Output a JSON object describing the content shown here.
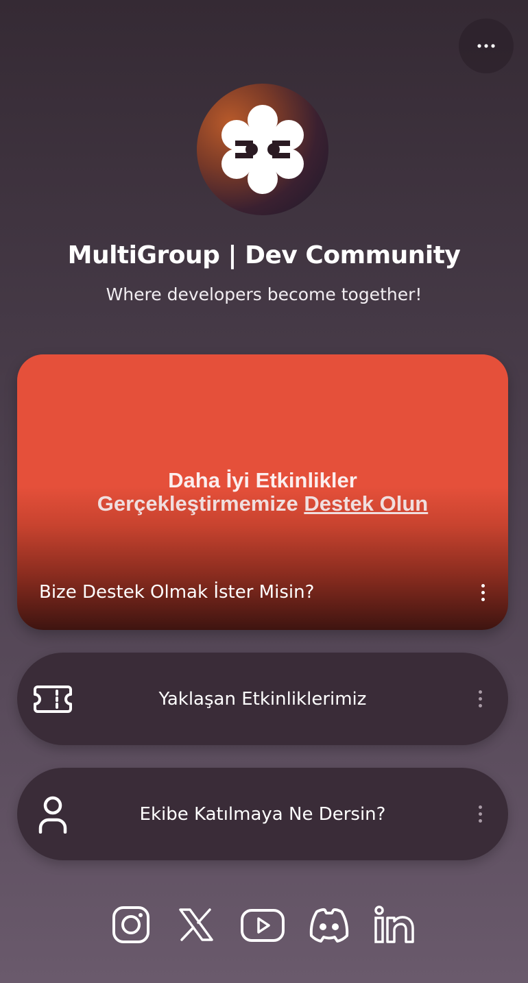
{
  "header": {
    "more_icon": "more-horizontal-icon"
  },
  "profile": {
    "avatar_icon": "multigroup-logo",
    "title": "MultiGroup | Dev Community",
    "subtitle": "Where developers become together!"
  },
  "feature_card": {
    "banner_line1": "Daha İyi Etkinlikler",
    "banner_line2_prefix": "Gerçekleştirmemize ",
    "banner_line2_link": "Destek Olun",
    "caption": "Bize Destek Olmak İster Misin?",
    "menu_icon": "more-vertical-icon"
  },
  "links": [
    {
      "label": "Yaklaşan Etkinliklerimiz",
      "icon": "ticket-icon",
      "menu_icon": "more-vertical-icon"
    },
    {
      "label": "Ekibe Katılmaya Ne Dersin?",
      "icon": "user-icon",
      "menu_icon": "more-vertical-icon"
    }
  ],
  "socials": [
    {
      "icon": "instagram-icon"
    },
    {
      "icon": "x-icon"
    },
    {
      "icon": "youtube-icon"
    },
    {
      "icon": "discord-icon"
    },
    {
      "icon": "linkedin-icon"
    }
  ],
  "colors": {
    "background_top": "#352a34",
    "background_bottom": "#6a5a6c",
    "feature_accent": "#e5503a",
    "card": "#3a2c38",
    "text": "#ffffff"
  }
}
